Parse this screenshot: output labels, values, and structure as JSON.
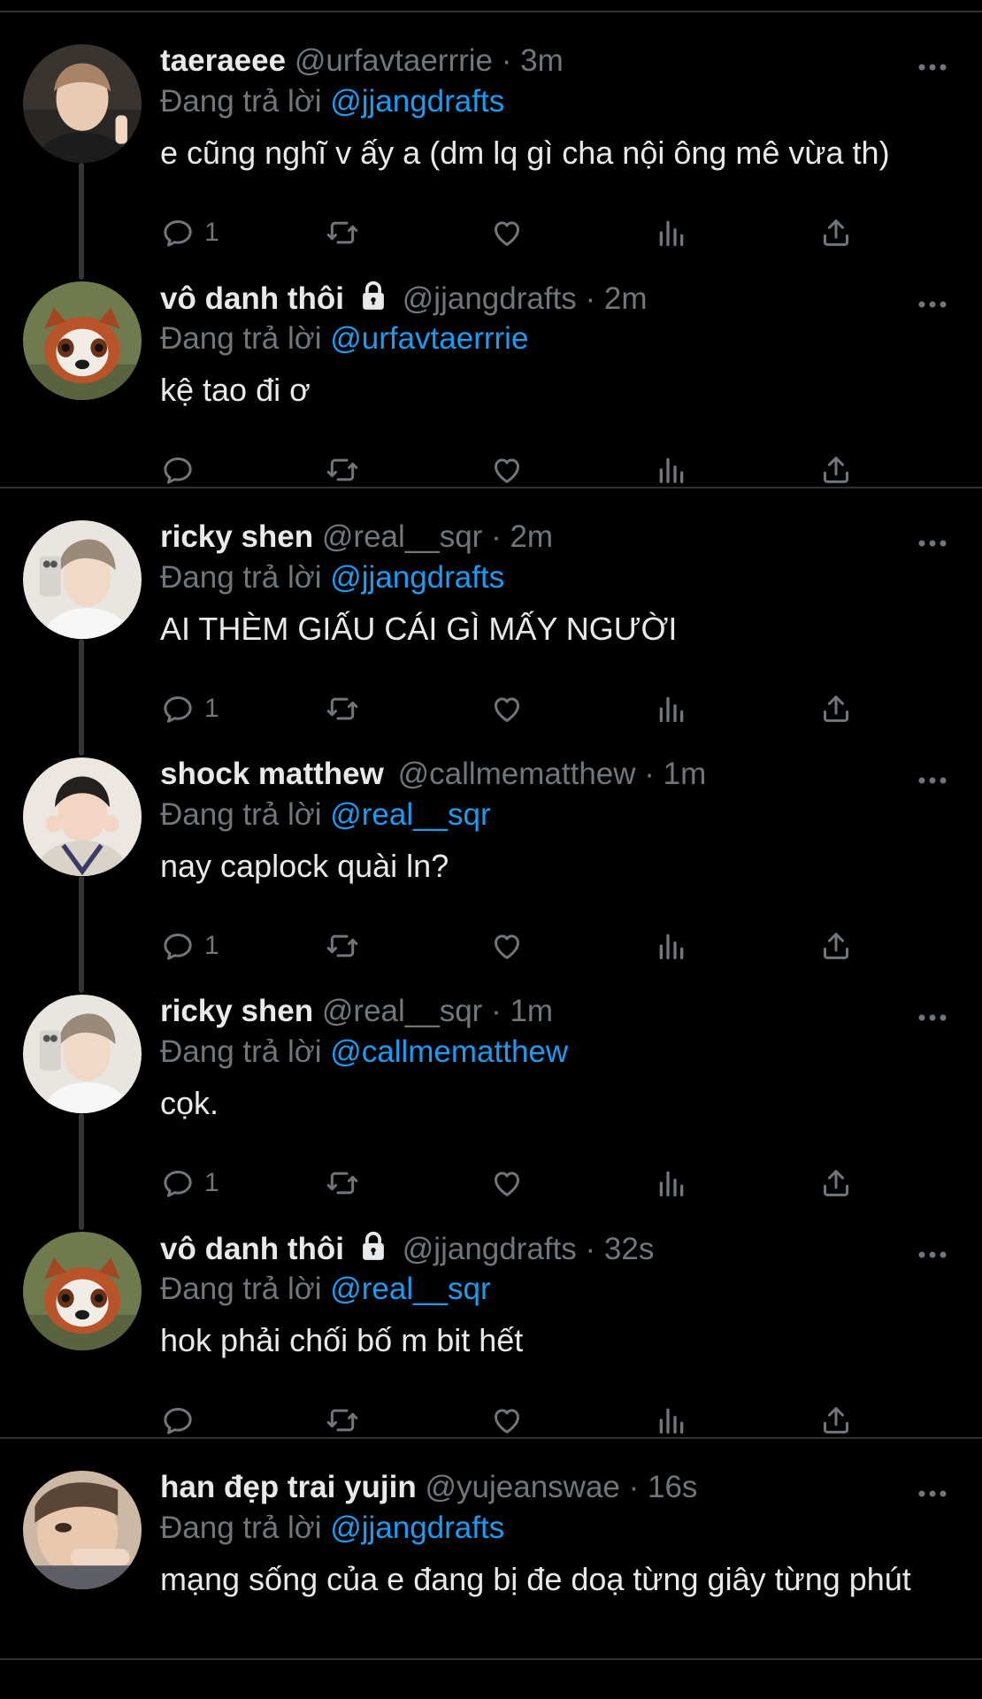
{
  "colors": {
    "background": "#000000",
    "text": "#e7e9ea",
    "muted": "#71767b",
    "link": "#1d9bf0",
    "divider": "#2f3336"
  },
  "icons": {
    "reply": "reply-icon",
    "retweet": "retweet-icon",
    "like": "heart-icon",
    "views": "views-icon",
    "share": "share-icon",
    "more": "more-icon",
    "lock": "lock-icon"
  },
  "tweets": [
    {
      "name": "taeraeee",
      "handle": "@urfavtaerrrie",
      "dot": "·",
      "time": "3m",
      "replying_prefix": "Đang trả lời",
      "replying_to": "@jjangdrafts",
      "text": "e cũng nghĩ v ấy a (dm lq gì cha nội ông mê vừa th)",
      "reply_count": "1"
    },
    {
      "name": "vô danh thôi",
      "handle": "@jjangdrafts",
      "dot": "·",
      "time": "2m",
      "replying_prefix": "Đang trả lời",
      "replying_to": "@urfavtaerrrie",
      "text": "kệ tao đi ơ",
      "reply_count": ""
    },
    {
      "name": "ricky shen",
      "handle": "@real__sqr",
      "dot": "·",
      "time": "2m",
      "replying_prefix": "Đang trả lời",
      "replying_to": "@jjangdrafts",
      "text": "AI THÈM GIẤU CÁI GÌ MẤY NGƯỜI",
      "reply_count": "1"
    },
    {
      "name": "shock matthew",
      "handle": "@callmematthew",
      "dot": "·",
      "time": "1m",
      "replying_prefix": "Đang trả lời",
      "replying_to": "@real__sqr",
      "text": "nay caplock quài ln?",
      "reply_count": "1"
    },
    {
      "name": "ricky shen",
      "handle": "@real__sqr",
      "dot": "·",
      "time": "1m",
      "replying_prefix": "Đang trả lời",
      "replying_to": "@callmematthew",
      "text": "cọk.",
      "reply_count": "1"
    },
    {
      "name": "vô danh thôi",
      "handle": "@jjangdrafts",
      "dot": "·",
      "time": "32s",
      "replying_prefix": "Đang trả lời",
      "replying_to": "@real__sqr",
      "text": "hok phải chối bố m bit hết",
      "reply_count": ""
    },
    {
      "name": "han đẹp trai yujin",
      "handle": "@yujeanswae",
      "dot": "·",
      "time": "16s",
      "replying_prefix": "Đang trả lời",
      "replying_to": "@jjangdrafts",
      "text": "mạng sống của e đang bị đe doạ từng giây từng phút",
      "reply_count": ""
    }
  ]
}
